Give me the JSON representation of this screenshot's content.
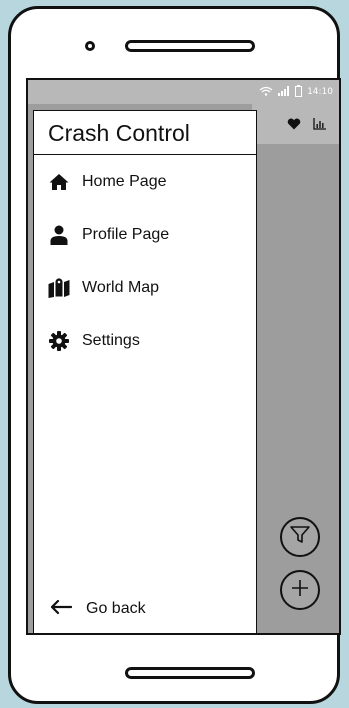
{
  "status_bar": {
    "time": "14:10",
    "icons": [
      "wifi-icon",
      "signal-icon",
      "battery-icon"
    ]
  },
  "app_bar": {
    "actions": [
      "heart-icon",
      "bar-chart-icon"
    ]
  },
  "drawer": {
    "title": "Crash Control",
    "items": [
      {
        "label": "Home Page",
        "icon": "home-icon"
      },
      {
        "label": "Profile Page",
        "icon": "person-icon"
      },
      {
        "label": "World Map",
        "icon": "map-icon"
      },
      {
        "label": "Settings",
        "icon": "gear-icon"
      }
    ],
    "back_label": "Go back"
  },
  "fabs": [
    "filter-icon",
    "add-icon"
  ]
}
